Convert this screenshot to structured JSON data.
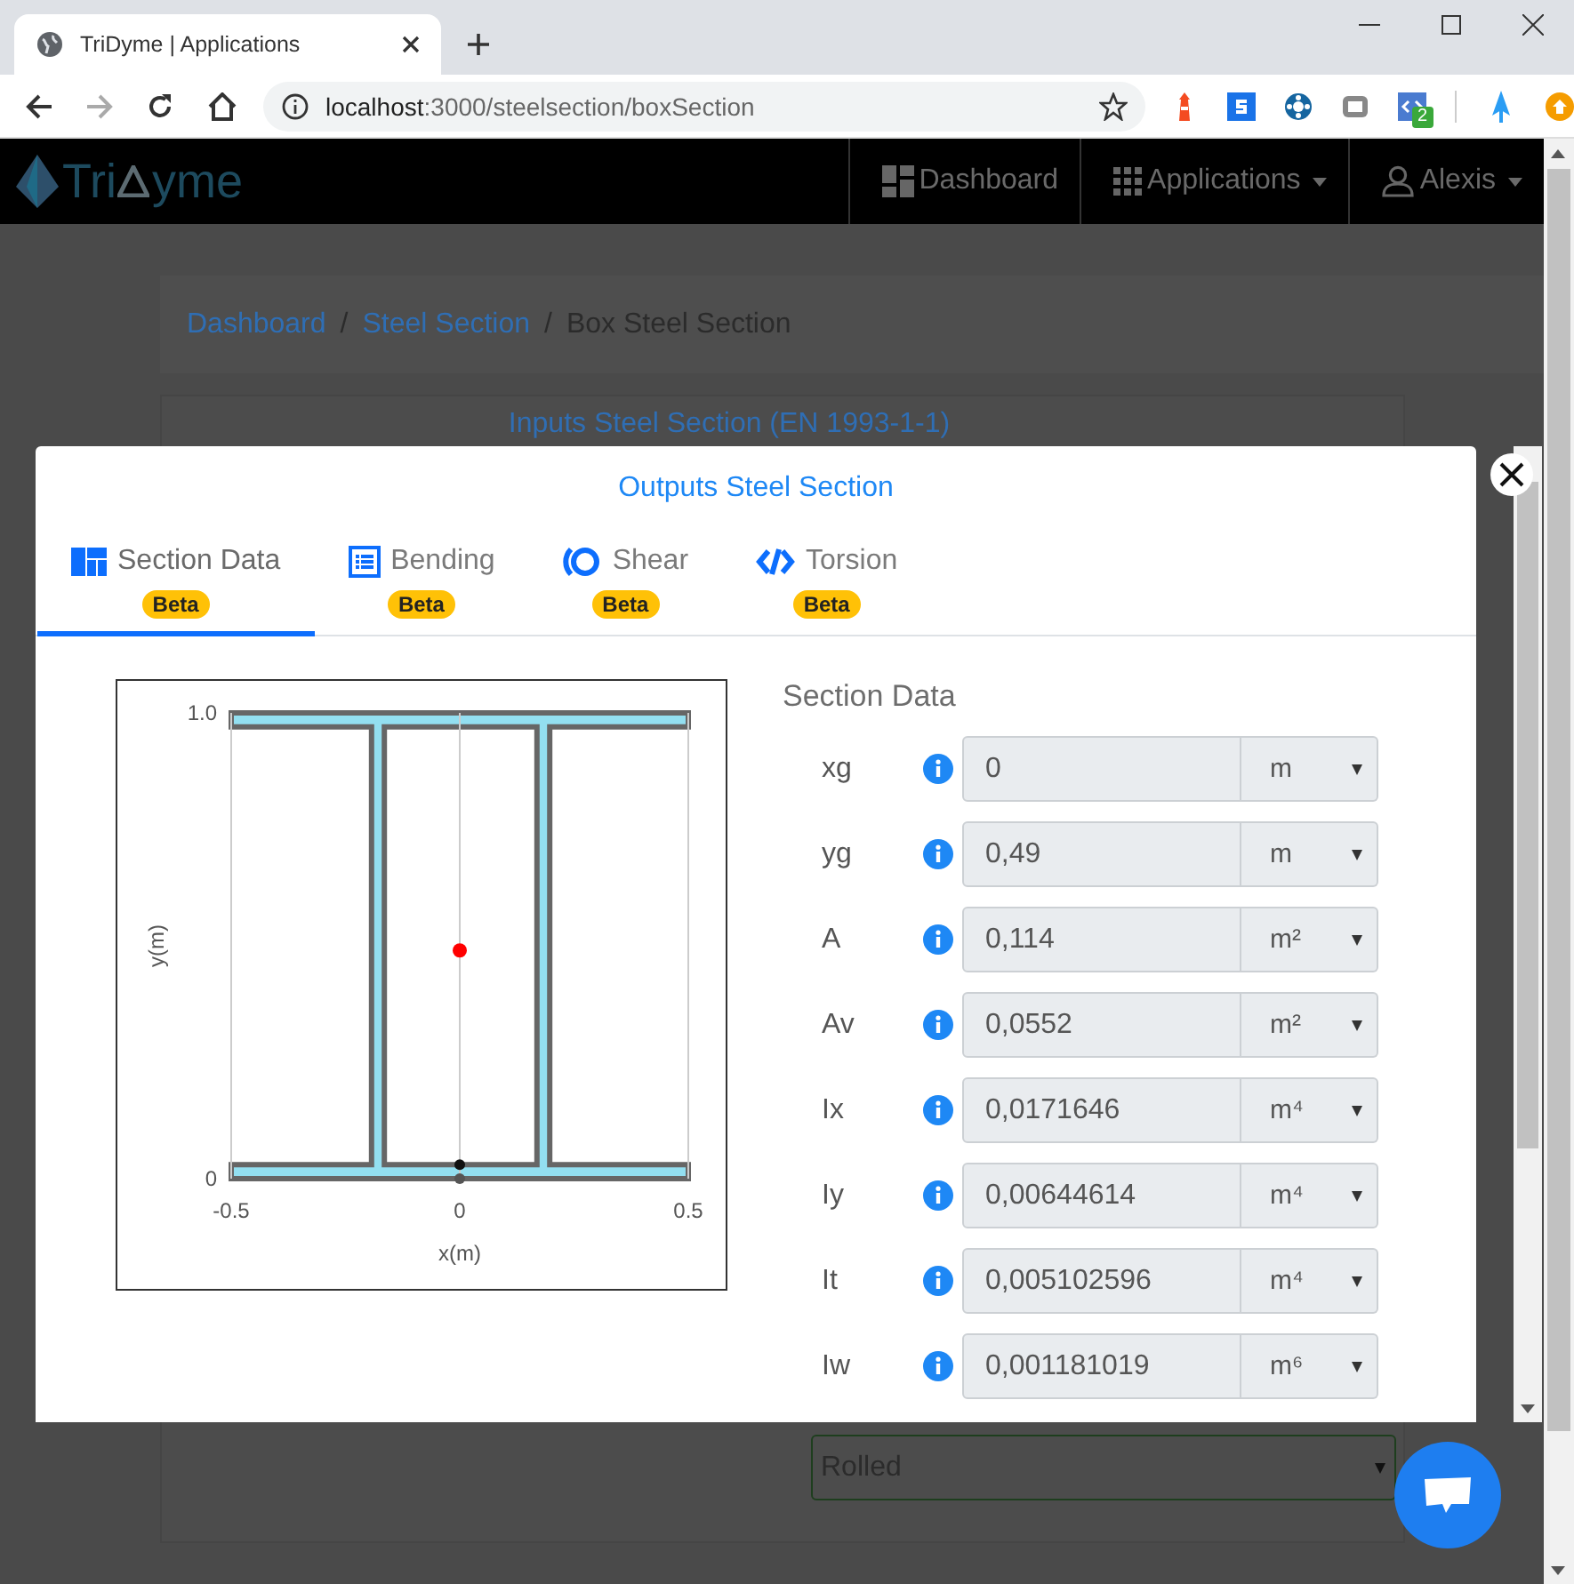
{
  "browser": {
    "tab_title": "TriDyme | Applications",
    "url_host": "localhost",
    "url_path": ":3000/steelsection/boxSection",
    "extension_badge": "2"
  },
  "navbar": {
    "brand_left": "Tri",
    "brand_right": "yme",
    "items": [
      {
        "label": "Dashboard",
        "kind": "dashboard",
        "dropdown": false
      },
      {
        "label": "Applications",
        "kind": "apps",
        "dropdown": true
      },
      {
        "label": "Alexis",
        "kind": "user",
        "dropdown": true
      }
    ]
  },
  "breadcrumb": {
    "separator": "/",
    "items": [
      {
        "label": "Dashboard",
        "link": true
      },
      {
        "label": "Steel Section",
        "link": true
      },
      {
        "label": "Box Steel Section",
        "link": false
      }
    ]
  },
  "inputs_card": {
    "title": "Inputs Steel Section (EN 1993-1-1)",
    "fabrication": "Rolled"
  },
  "modal": {
    "title": "Outputs Steel Section",
    "tabs": [
      {
        "label": "Section Data",
        "badge": "Beta",
        "kind": "layout",
        "selected": true
      },
      {
        "label": "Bending",
        "badge": "Beta",
        "kind": "list",
        "selected": false
      },
      {
        "label": "Shear",
        "badge": "Beta",
        "kind": "ring",
        "selected": false
      },
      {
        "label": "Torsion",
        "badge": "Beta",
        "kind": "code",
        "selected": false
      }
    ],
    "section_data": {
      "heading": "Section Data",
      "chart_data": {
        "type": "scatter",
        "xlabel": "x(m)",
        "ylabel": "y(m)",
        "xlim": [
          -0.5,
          0.5
        ],
        "ylim": [
          0,
          1
        ],
        "xticks": [
          -0.5,
          0,
          0.5
        ],
        "yticks": [
          0,
          {
            "value": 1,
            "label": "1.0"
          }
        ],
        "x": [
          0
        ],
        "series": [
          {
            "color": "#ff0000",
            "values": [
              0.49
            ]
          },
          {
            "color": "#111111",
            "values": [
              0.03
            ]
          },
          {
            "color": "#555555",
            "values": [
              0
            ]
          }
        ]
      },
      "rows": [
        {
          "label": "xg",
          "value": "0",
          "unit": "m"
        },
        {
          "label": "yg",
          "value": "0,49",
          "unit": "m"
        },
        {
          "label": "A",
          "value": "0,114",
          "unit": "m²"
        },
        {
          "label": "Av",
          "value": "0,0552",
          "unit": "m²"
        },
        {
          "label": "Ix",
          "value": "0,0171646",
          "unit": "m⁴"
        },
        {
          "label": "Iy",
          "value": "0,00644614",
          "unit": "m⁴"
        },
        {
          "label": "It",
          "value": "0,005102596",
          "unit": "m⁴"
        },
        {
          "label": "Iw",
          "value": "0,001181019",
          "unit": "m⁶"
        }
      ]
    }
  }
}
